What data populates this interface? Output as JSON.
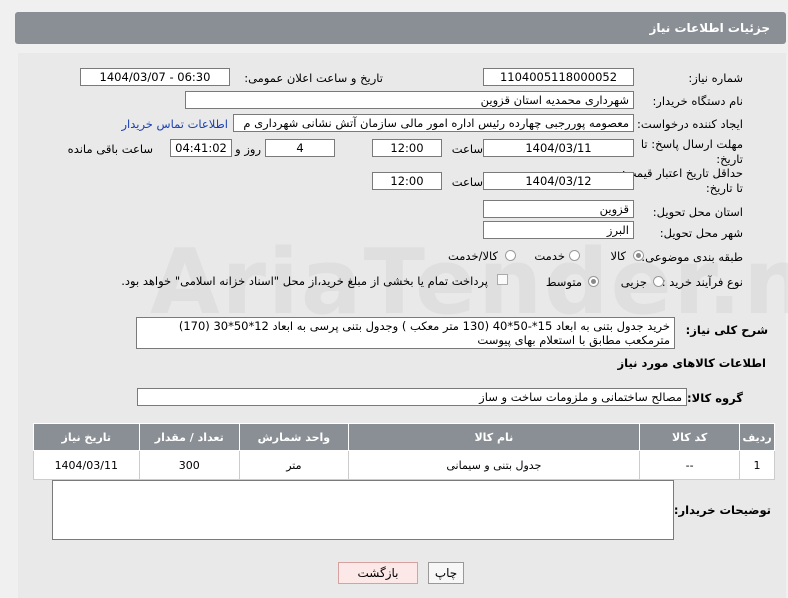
{
  "header": {
    "title": "جزئیات اطلاعات نیاز"
  },
  "fields": {
    "need_number_label": "شماره نیاز:",
    "need_number": "1104005118000052",
    "announce_label": "تاریخ و ساعت اعلان عمومی:",
    "announce_value": "1404/03/07 - 06:30",
    "buyer_org_label": "نام دستگاه خریدار:",
    "buyer_org": "شهرداری محمدیه استان قزوین",
    "creator_label": "ایجاد کننده درخواست:",
    "creator": "معصومه پوررجبی چهارده رئیس اداره امور مالی سازمان آتش نشانی شهرداری م",
    "contact_link": "اطلاعات تماس خریدار",
    "deadline_label": "مهلت ارسال پاسخ: تا تاریخ:",
    "deadline_date": "1404/03/11",
    "time_label": "ساعت",
    "deadline_time": "12:00",
    "days": "4",
    "days_label": "روز و",
    "remaining": "04:41:02",
    "remaining_label": "ساعت باقی مانده",
    "price_label": "حداقل تاریخ اعتبار قیمت: تا تاریخ:",
    "price_date": "1404/03/12",
    "price_time": "12:00",
    "province_label": "استان محل تحویل:",
    "province": "قزوین",
    "city_label": "شهر محل تحویل:",
    "city": "البرز",
    "category_label": "طبقه بندی موضوعی:",
    "cat_goods": "کالا",
    "cat_service": "خدمت",
    "cat_goods_service": "کالا/خدمت",
    "process_label": "نوع فرآیند خرید :",
    "proc_partial": "جزیی",
    "proc_medium": "متوسط",
    "payment_note": "پرداخت تمام یا بخشی از مبلغ خرید،از محل \"اسناد خزانه اسلامی\" خواهد بود."
  },
  "description": {
    "label": "شرح کلی نیاز:",
    "line1": "خرید جدول بتنی به ابعاد 15*-50*40 (130 متر معکب ) وجدول بتنی پرسی به ابعاد 12*50*30 (170)",
    "line2": "مترمکعب مطابق با استعلام بهای پیوست"
  },
  "goods_section": {
    "title": "اطلاعات کالاهای مورد نیاز",
    "group_label": "گروه کالا:",
    "group_value": "مصالح ساختمانی و ملزومات ساخت و ساز"
  },
  "table": {
    "headers": [
      "ردیف",
      "کد کالا",
      "نام کالا",
      "واحد شمارش",
      "تعداد / مقدار",
      "تاریخ نیاز"
    ],
    "rows": [
      [
        "1",
        "--",
        "جدول بتنی و سیمانی",
        "متر",
        "300",
        "1404/03/11"
      ]
    ]
  },
  "buyer_notes": {
    "label": "توضیحات خریدار:"
  },
  "buttons": {
    "print": "چاپ",
    "back": "بازگشت"
  },
  "watermark": "AriaTender.neT"
}
